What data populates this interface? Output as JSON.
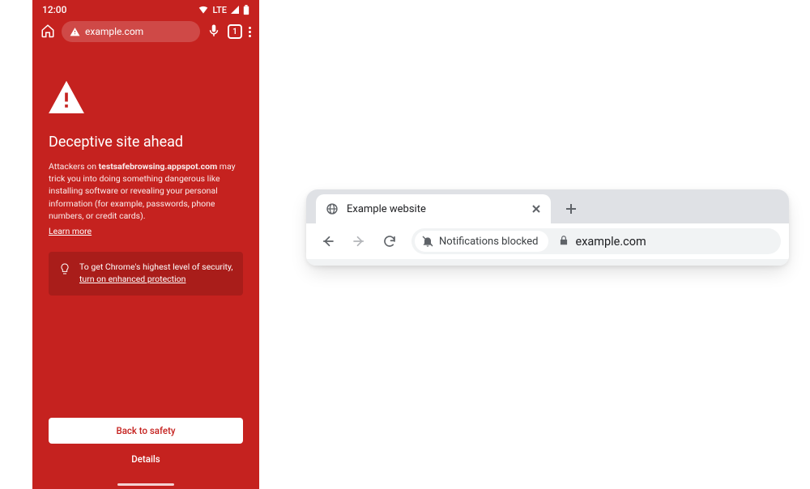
{
  "mobile": {
    "status": {
      "time": "12:00",
      "network": "LTE"
    },
    "address_bar": {
      "url_text": "example.com",
      "tab_count": "1"
    },
    "warning": {
      "heading": "Deceptive site ahead",
      "desc_prefix": "Attackers on ",
      "desc_bold": "testsafebrowsing.appspot.com",
      "desc_suffix": " may trick you into doing something dangerous like installing software or revealing your personal information (for example, passwords, phone numbers, or credit cards).",
      "learn_more": "Learn more"
    },
    "tip": {
      "line1": "To get Chrome's highest level of security, ",
      "underline": "turn on enhanced protection"
    },
    "back_to_safety": "Back to safety",
    "details": "Details"
  },
  "desktop": {
    "tab_title": "Example website",
    "chip_text": "Notifications blocked",
    "url_text": "example.com"
  }
}
